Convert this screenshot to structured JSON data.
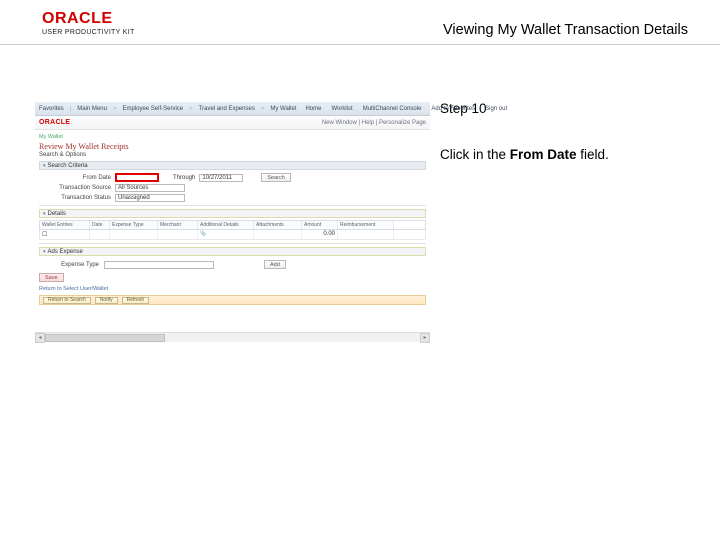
{
  "header": {
    "brand": "ORACLE",
    "sub_brand": "USER PRODUCTIVITY KIT",
    "page_title": "Viewing My Wallet Transaction Details"
  },
  "instructions": {
    "step_label": "Step 10",
    "text_prefix": "Click in the ",
    "field_name": "From Date",
    "text_suffix": " field."
  },
  "app": {
    "top_nav": {
      "items": [
        "Favorites",
        "Main Menu",
        "Employee Self-Service",
        "Travel and Expenses",
        "My Wallet"
      ],
      "right_items": [
        "Home",
        "Worklist",
        "MultiChannel Console",
        "Add to Favorites",
        "Sign out"
      ]
    },
    "brand_row": {
      "logo": "ORACLE",
      "crumbs": "New Window | Help | Personalize Page"
    },
    "breadcrumb": "My Wallet",
    "title": "Review My Wallet Receipts",
    "subtitle": "Search & Options",
    "criteria_label": "Search Criteria",
    "form": {
      "from_date_label": "From Date",
      "from_date_value": "",
      "through_label": "Through",
      "through_value": "10/27/2011",
      "search_btn": "Search",
      "source_label": "Transaction Source",
      "source_value": "All Sources",
      "status_label": "Transaction Status",
      "status_value": "Unassigned"
    },
    "details_label": "Details",
    "grid": {
      "headers": [
        "Wallet Entries",
        "Date",
        "Expense Type",
        "Merchant",
        "Additional Details",
        "Attachments",
        "Amount",
        "Reimbursement"
      ],
      "row": {
        "amount": "0.00"
      }
    },
    "ads_expense_label": "Ads Expense",
    "expense": {
      "type_label": "Expense Type",
      "type_value": "",
      "add_btn": "Add"
    },
    "save_btn": "Save",
    "result_link": "Return to Select User/Wallet",
    "result_bar": {
      "back_btn": "Return to Search",
      "notify_btn": "Notify",
      "refresh_btn": "Refresh"
    }
  }
}
